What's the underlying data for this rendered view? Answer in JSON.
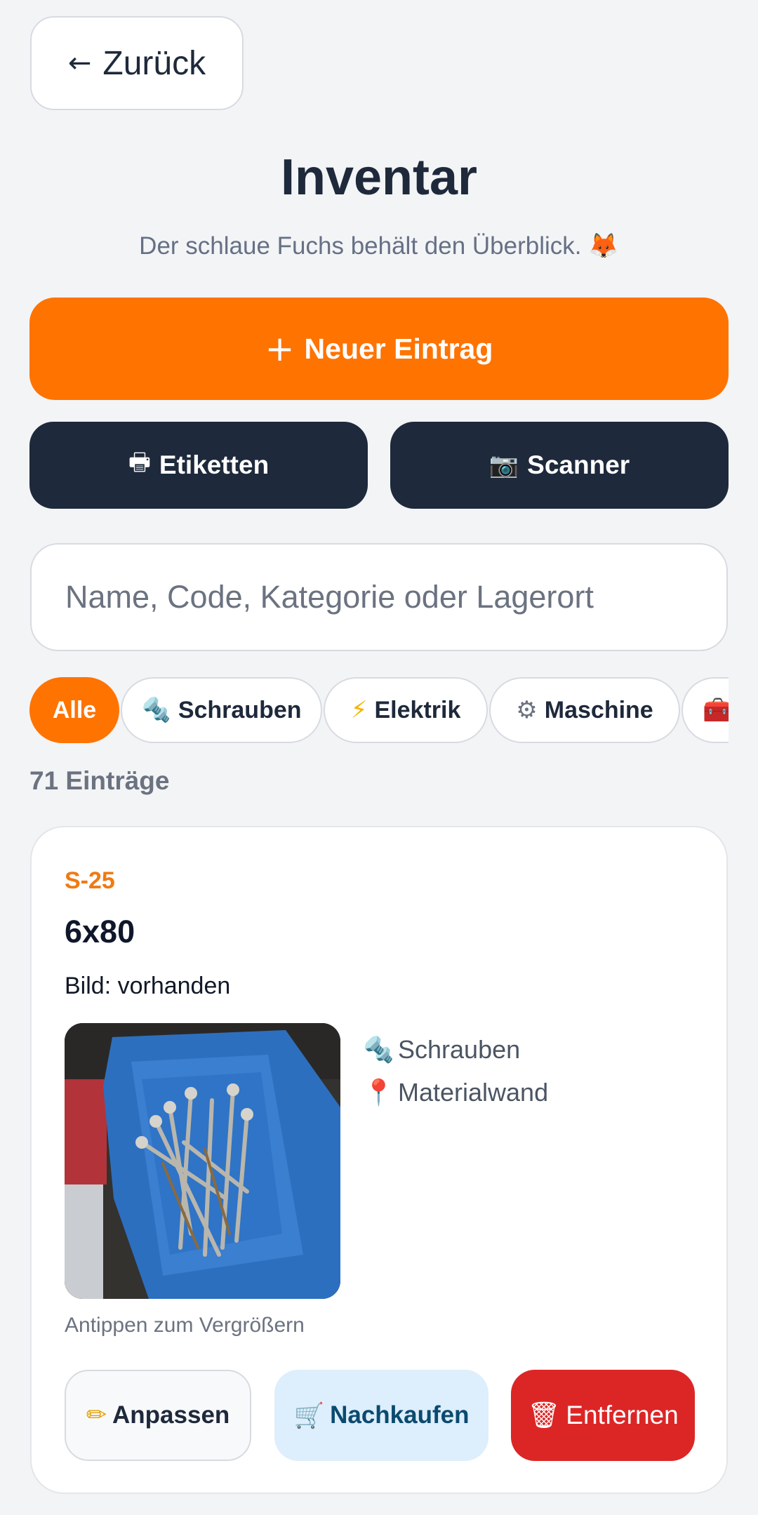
{
  "nav": {
    "back_label": "Zurück",
    "back_arrow": "←"
  },
  "header": {
    "title": "Inventar",
    "subtitle": "Der schlaue Fuchs behält den Überblick.",
    "subtitle_emoji": "🦊"
  },
  "actions": {
    "new_entry_icon": "+",
    "new_entry_label": "Neuer Eintrag",
    "labels_icon": "🖶",
    "labels_label": "Etiketten",
    "scanner_icon": "📷",
    "scanner_label": "Scanner"
  },
  "search": {
    "placeholder": "Name, Code, Kategorie oder Lagerort",
    "value": ""
  },
  "filters": [
    {
      "icon": "",
      "label": "Alle",
      "active": true
    },
    {
      "icon": "🔩",
      "label": "Schrauben",
      "active": false
    },
    {
      "icon": "⚡",
      "label": "Elektrik",
      "active": false
    },
    {
      "icon": "⚙",
      "label": "Maschine",
      "active": false
    },
    {
      "icon": "🧰",
      "label": "",
      "active": false
    }
  ],
  "results": {
    "count_label": "71 Einträge"
  },
  "items": [
    {
      "code": "S-25",
      "name": "6x80",
      "image_status": "Bild: vorhanden",
      "category_icon": "🔩",
      "category": "Schrauben",
      "location_icon": "📍",
      "location": "Materialwand",
      "tap_hint": "Antippen zum Vergrößern",
      "edit_icon": "✏",
      "edit_label": "Anpassen",
      "rebuy_icon": "🛒",
      "rebuy_label": "Nachkaufen",
      "delete_icon": "🗑",
      "delete_label": "Entfernen"
    }
  ],
  "colors": {
    "accent": "#ff7300",
    "dark_button": "#1e293b",
    "danger": "#dc2626",
    "rebuy_bg": "#ddeefc",
    "background": "#f3f4f6"
  }
}
